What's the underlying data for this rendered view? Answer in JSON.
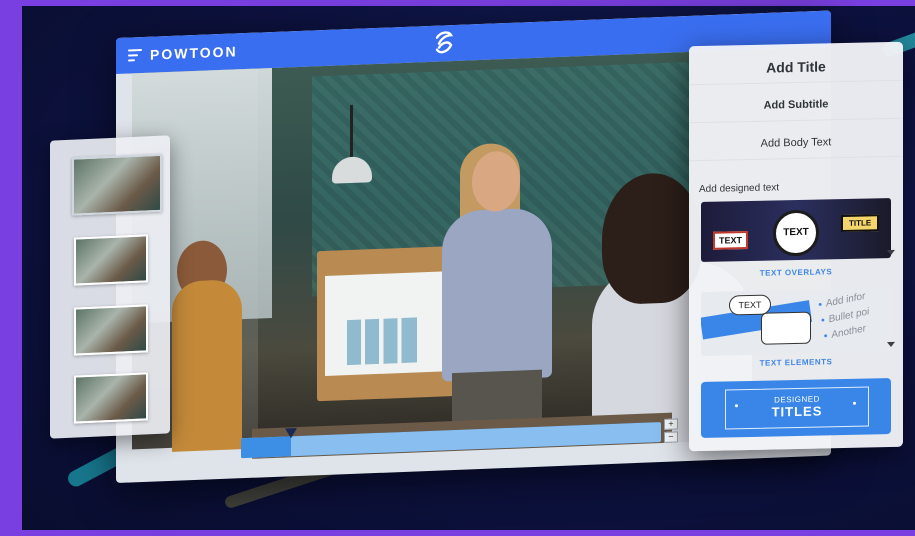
{
  "app": {
    "brand": "POWTOON"
  },
  "text_panel": {
    "add_title": "Add Title",
    "add_subtitle": "Add Subtitle",
    "add_body_text": "Add Body Text",
    "designed_text_label": "Add designed text",
    "overlays": {
      "label": "TEXT OVERLAYS",
      "samples": [
        "TEXT",
        "TEXT",
        "TITLE"
      ]
    },
    "elements": {
      "label": "TEXT ELEMENTS",
      "bubble": "TEXT",
      "list": [
        "Add infor",
        "Bullet poi",
        "Another"
      ]
    },
    "designed_titles": {
      "small": "DESIGNED",
      "big": "TITLES"
    }
  },
  "timeline": {
    "zoom_in": "+",
    "zoom_out": "−",
    "playhead_progress": 0.12
  },
  "thumbnails": {
    "count": 4,
    "active_index": 0
  },
  "colors": {
    "accent": "#3a6ef0",
    "panel_link": "#3f86e8",
    "background": "#0d1240"
  },
  "icons": {
    "menu": "hamburger-menu-icon",
    "logo": "powtoon-logo-icon",
    "dropdown": "caret-down-icon"
  }
}
